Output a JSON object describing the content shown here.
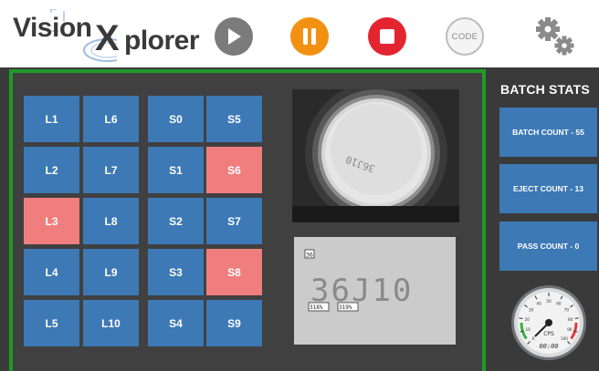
{
  "app": {
    "logo_prefix": "Vision",
    "logo_x": "X",
    "logo_suffix": "plorer"
  },
  "toolbar": {
    "play_icon": "play-icon",
    "pause_icon": "pause-icon",
    "stop_icon": "stop-icon",
    "code_label": "CODE",
    "settings_icon": "gear-icon"
  },
  "colors": {
    "tile_normal": "#3d79b5",
    "tile_alert": "#f07e7e",
    "panel_border": "#1f9a2a",
    "play": "#7b7b7b",
    "pause": "#f29111",
    "stop": "#e3252f"
  },
  "lanes": {
    "left": [
      {
        "label": "L1",
        "alert": false
      },
      {
        "label": "L2",
        "alert": false
      },
      {
        "label": "L3",
        "alert": true
      },
      {
        "label": "L4",
        "alert": false
      },
      {
        "label": "L5",
        "alert": false
      }
    ],
    "right": [
      {
        "label": "L6",
        "alert": false
      },
      {
        "label": "L7",
        "alert": false
      },
      {
        "label": "L8",
        "alert": false
      },
      {
        "label": "L9",
        "alert": false
      },
      {
        "label": "L10",
        "alert": false
      }
    ]
  },
  "stations": {
    "left": [
      {
        "label": "S0",
        "alert": false
      },
      {
        "label": "S1",
        "alert": false
      },
      {
        "label": "S2",
        "alert": false
      },
      {
        "label": "S3",
        "alert": false
      },
      {
        "label": "S4",
        "alert": false
      }
    ],
    "right": [
      {
        "label": "S5",
        "alert": false
      },
      {
        "label": "S6",
        "alert": true
      },
      {
        "label": "S7",
        "alert": false
      },
      {
        "label": "S8",
        "alert": true
      },
      {
        "label": "S9",
        "alert": false
      }
    ]
  },
  "camera": {
    "top_text": "36J10",
    "ocr_text": "36J10",
    "ocr_box_label": "36",
    "ocr_conf_1": "318%",
    "ocr_conf_2": "319%"
  },
  "stats": {
    "title": "BATCH STATS",
    "batch_count": "BATCH COUNT - 55",
    "eject_count": "EJECT COUNT - 13",
    "pass_count": "PASS COUNT - 0"
  },
  "gauge": {
    "label": "CPS",
    "readout": "00:00",
    "ticks": [
      "0",
      "10",
      "20",
      "30",
      "40",
      "50",
      "60",
      "70",
      "80",
      "90",
      "100"
    ]
  }
}
